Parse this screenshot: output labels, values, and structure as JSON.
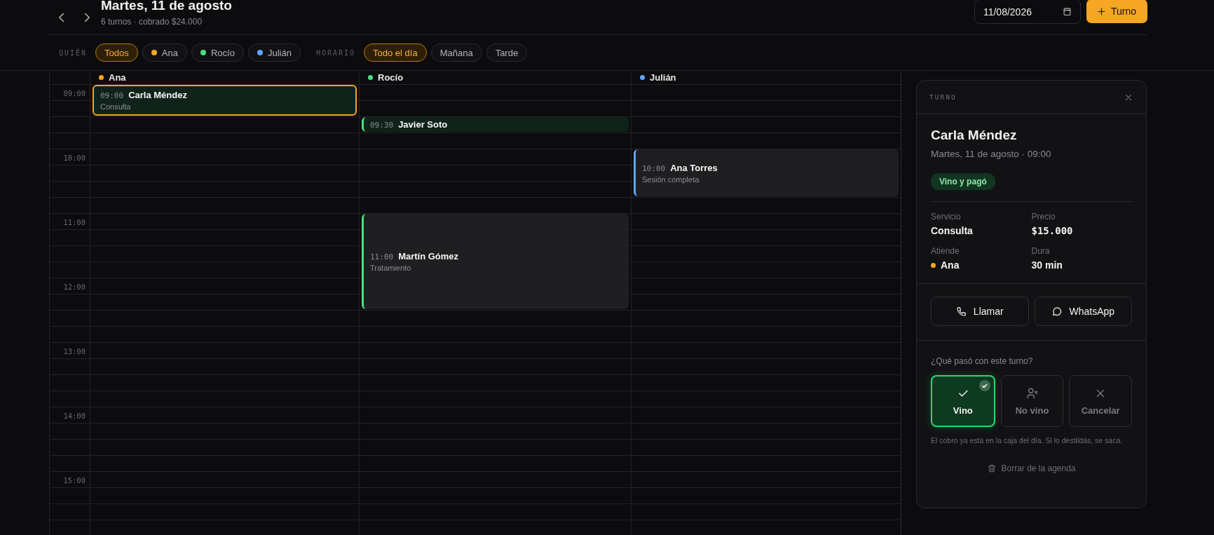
{
  "header": {
    "title": "Martes, 11 de agosto",
    "subtitle": "6 turnos · cobrado $24.000",
    "date_value": "11/08/2026",
    "new_button": "Turno"
  },
  "filters": [
    {
      "label": "QUIÉN",
      "chips": [
        {
          "label": "Todos",
          "selected": true
        },
        {
          "label": "Ana",
          "selected": false,
          "color": "#f5a623"
        },
        {
          "label": "Rocío",
          "selected": false,
          "color": "#4ade80"
        },
        {
          "label": "Julián",
          "selected": false,
          "color": "#60a5fa"
        }
      ]
    },
    {
      "label": "HORARIO",
      "chips": [
        {
          "label": "Todo el día",
          "selected": true
        },
        {
          "label": "Mañana",
          "selected": false
        },
        {
          "label": "Tarde",
          "selected": false
        }
      ]
    }
  ],
  "calendar": {
    "times": [
      "09:00",
      "10:00",
      "11:00",
      "12:00",
      "13:00",
      "14:00",
      "15:00"
    ],
    "columns": [
      {
        "name": "Ana",
        "color": "#f5a623",
        "events": [
          {
            "time": "09:00",
            "name": "Carla Méndez",
            "service": "Consulta",
            "kind": "half",
            "paid": true,
            "selected": true
          }
        ]
      },
      {
        "name": "Rocío",
        "color": "#4ade80",
        "events": [
          {
            "time": "09:30",
            "name": "Javier Soto",
            "kind": "quarter",
            "paid": true,
            "selected": false
          },
          {
            "time": "11:00",
            "name": "Martín Gómez",
            "service": "Tratamiento",
            "kind": "ninety",
            "paid": false,
            "selected": false
          }
        ]
      },
      {
        "name": "Julián",
        "color": "#60a5fa",
        "events": [
          {
            "time": "10:00",
            "name": "Ana Torres",
            "service": "Sesión completa",
            "kind": "threequarters",
            "paid": false,
            "selected": false
          }
        ]
      }
    ]
  },
  "panel": {
    "label": "TURNO",
    "name": "Carla Méndez",
    "when": "Martes, 11 de agosto · 09:00",
    "status_badge": "Vino y pagó",
    "details": [
      {
        "kind": "text",
        "label": "Servicio",
        "value": "Consulta"
      },
      {
        "kind": "money",
        "label": "Precio",
        "value": "$15.000"
      },
      {
        "kind": "person",
        "label": "Atiende",
        "value": "Ana",
        "color": "#f5a623"
      },
      {
        "kind": "text",
        "label": "Dura",
        "value": "30 min"
      }
    ],
    "actions": [
      {
        "kind": "phone",
        "label": "Llamar"
      },
      {
        "kind": "chat",
        "label": "WhatsApp"
      }
    ],
    "question": "¿Qué pasó con este turno?",
    "outcomes": [
      {
        "kind": "check",
        "label": "Vino",
        "selected": true
      },
      {
        "kind": "person-x",
        "label": "No vino",
        "selected": false
      },
      {
        "kind": "x",
        "label": "Cancelar",
        "selected": false
      }
    ],
    "note": "El cobro ya está en la caja del día. Si lo destildás, se saca.",
    "delete_label": "Borrar de la agenda"
  }
}
